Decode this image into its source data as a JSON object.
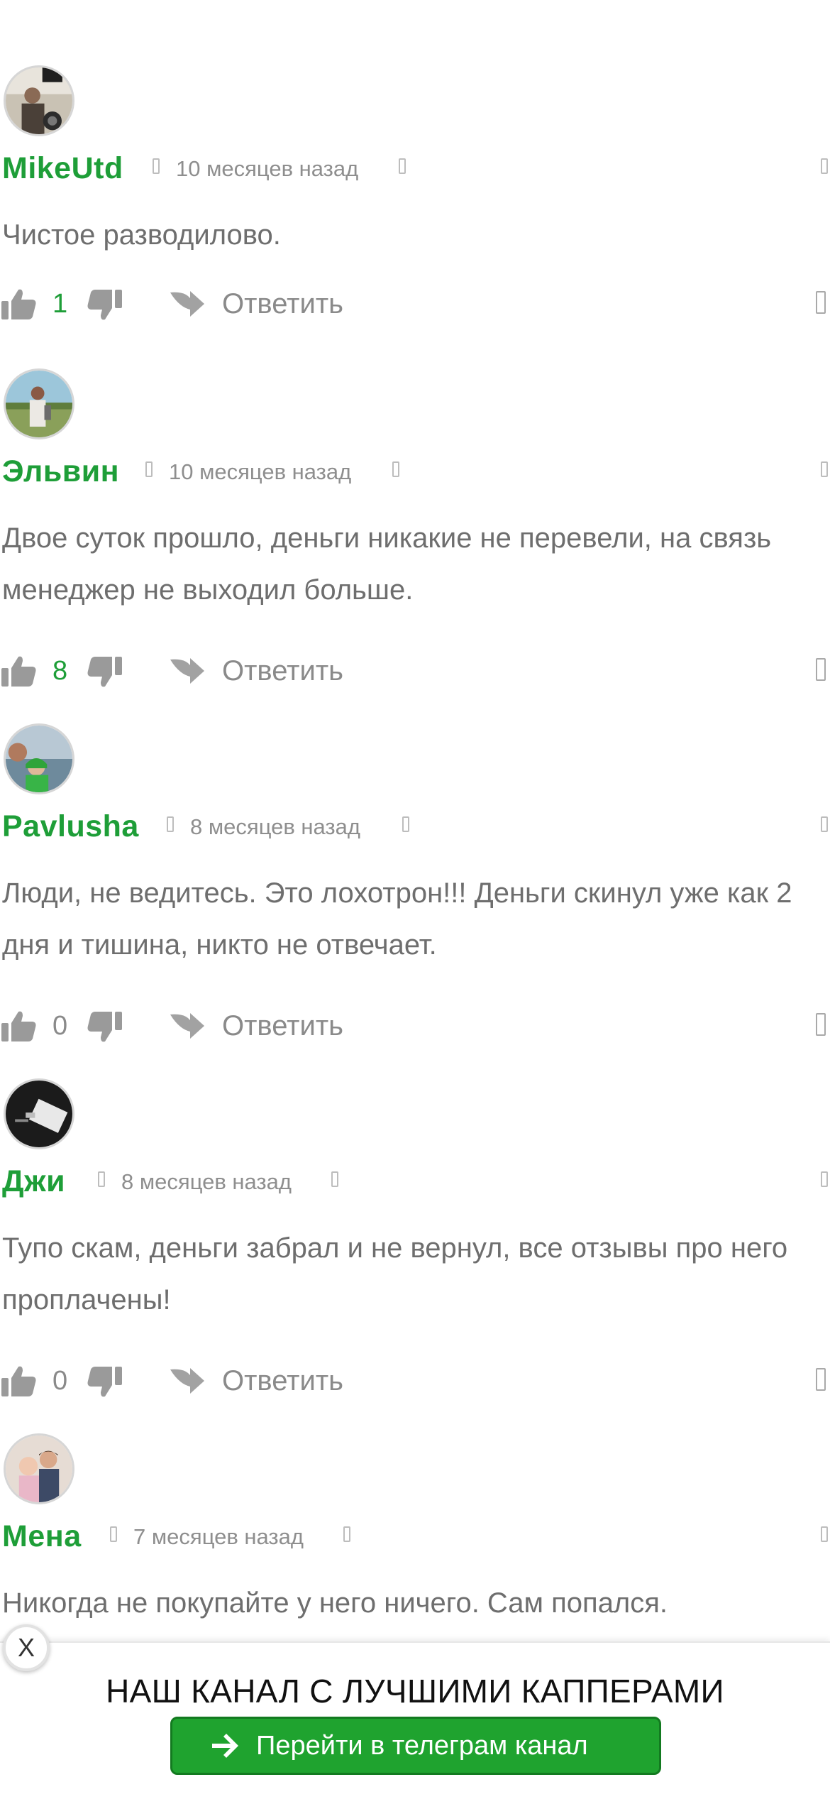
{
  "comments": [
    {
      "author": "MikeUtd",
      "time": "10 месяцев назад",
      "text": "Чистое разводилово.",
      "likes": "1"
    },
    {
      "author": "Эльвин",
      "time": "10 месяцев назад",
      "text": "Двое суток прошло, деньги никакие не перевели, на связь менеджер не выходил больше.",
      "likes": "8"
    },
    {
      "author": "Pavlusha",
      "time": "8 месяцев назад",
      "text": "Люди, не ведитесь. Это лохотрон!!! Деньги скинул уже как 2 дня и тишина, никто не отвечает.",
      "likes": "0"
    },
    {
      "author": "Джи",
      "time": "8 месяцев назад",
      "text": "Тупо скам, деньги забрал и не вернул, все отзывы про него проплачены!",
      "likes": "0"
    },
    {
      "author": "Мена",
      "time": "7 месяцев назад",
      "text": "Никогда не покупайте у него ничего. Сам попался.",
      "likes": ""
    }
  ],
  "reply_label": "Ответить",
  "banner": {
    "close_label": "X",
    "title": "НАШ КАНАЛ С ЛУЧШИМИ КАППЕРАМИ",
    "button_label": "Перейти в телеграм канал"
  },
  "colors": {
    "author_green": "#1e9e38",
    "button_green": "#1fa32f",
    "text_gray": "#6e6e6e",
    "icon_gray": "#9a9a9a"
  }
}
